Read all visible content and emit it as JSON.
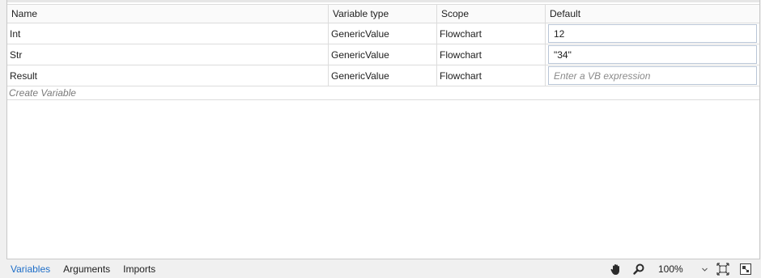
{
  "columns": {
    "name": "Name",
    "type": "Variable type",
    "scope": "Scope",
    "default": "Default"
  },
  "variables": [
    {
      "name": "Int",
      "type": "GenericValue",
      "scope": "Flowchart",
      "default": "12"
    },
    {
      "name": "Str",
      "type": "GenericValue",
      "scope": "Flowchart",
      "default": "\"34\""
    },
    {
      "name": "Result",
      "type": "GenericValue",
      "scope": "Flowchart",
      "default": ""
    }
  ],
  "default_placeholder": "Enter a VB expression",
  "create_variable_label": "Create Variable",
  "footer": {
    "tabs": [
      "Variables",
      "Arguments",
      "Imports"
    ],
    "active_tab": "Variables",
    "zoom_value": "100%",
    "icons": [
      "hand-icon",
      "magnifier-icon",
      "chevron-down-icon",
      "fit-to-screen-icon",
      "overview-icon"
    ]
  },
  "colors": {
    "active_tab": "#1e6ec8",
    "input_border": "#b9c5d6",
    "placeholder": "#8a8a8a"
  }
}
